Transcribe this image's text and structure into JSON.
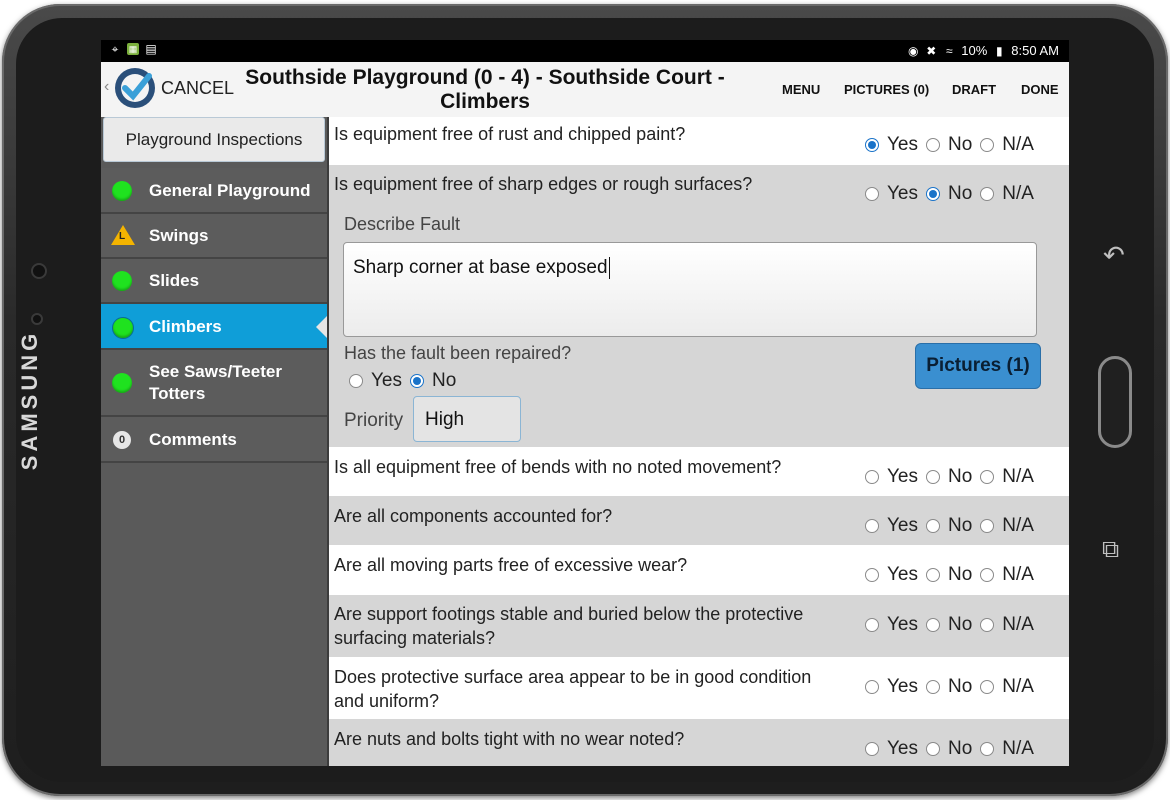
{
  "device": {
    "brand": "SAMSUNG"
  },
  "statusbar": {
    "left_icons": [
      "wifi-hotspot-icon",
      "app-icon",
      "screenshot-icon"
    ],
    "battery": "10%",
    "time": "8:50 AM"
  },
  "header": {
    "cancel_label": "CANCEL",
    "title": "Southside Playground (0 - 4) - Southside Court - Climbers",
    "menu_label": "MENU",
    "pictures_label": "PICTURES (0)",
    "draft_label": "DRAFT",
    "done_label": "DONE"
  },
  "sidebar": {
    "header": "Playground Inspections",
    "items": [
      {
        "label": "General Playground",
        "status": "green"
      },
      {
        "label": "Swings",
        "status": "warning"
      },
      {
        "label": "Slides",
        "status": "green"
      },
      {
        "label": "Climbers",
        "status": "green",
        "active": true
      },
      {
        "label": "See Saws/Teeter Totters",
        "status": "green"
      },
      {
        "label": "Comments",
        "status": "count",
        "count": "0"
      }
    ]
  },
  "options": {
    "yes": "Yes",
    "no": "No",
    "na": "N/A"
  },
  "questions": [
    {
      "text": "Is equipment free of rust and chipped paint?",
      "answer": "Yes"
    },
    {
      "text": "Is equipment free of sharp edges or rough surfaces?",
      "answer": "No"
    },
    {
      "text": "Is all equipment free of bends with no noted movement?",
      "answer": ""
    },
    {
      "text": "Are all components accounted for?",
      "answer": ""
    },
    {
      "text": "Are all moving parts free of excessive wear?",
      "answer": ""
    },
    {
      "text": "Are support footings stable and buried below the protective surfacing materials?",
      "answer": ""
    },
    {
      "text": "Does protective surface area appear to be in good condition and uniform?",
      "answer": ""
    },
    {
      "text": "Are nuts and bolts tight with no wear noted?",
      "answer": ""
    }
  ],
  "fault": {
    "describe_label": "Describe Fault",
    "description": "Sharp corner at base exposed",
    "repaired_label": "Has the fault been repaired?",
    "repaired_answer": "No",
    "priority_label": "Priority",
    "priority_value": "High",
    "pictures_button": "Pictures (1)"
  },
  "colors": {
    "active_nav": "#0f9ed8",
    "status_green": "#1fe21f",
    "status_warning": "#f4b400",
    "button_blue": "#3a8fd0"
  }
}
